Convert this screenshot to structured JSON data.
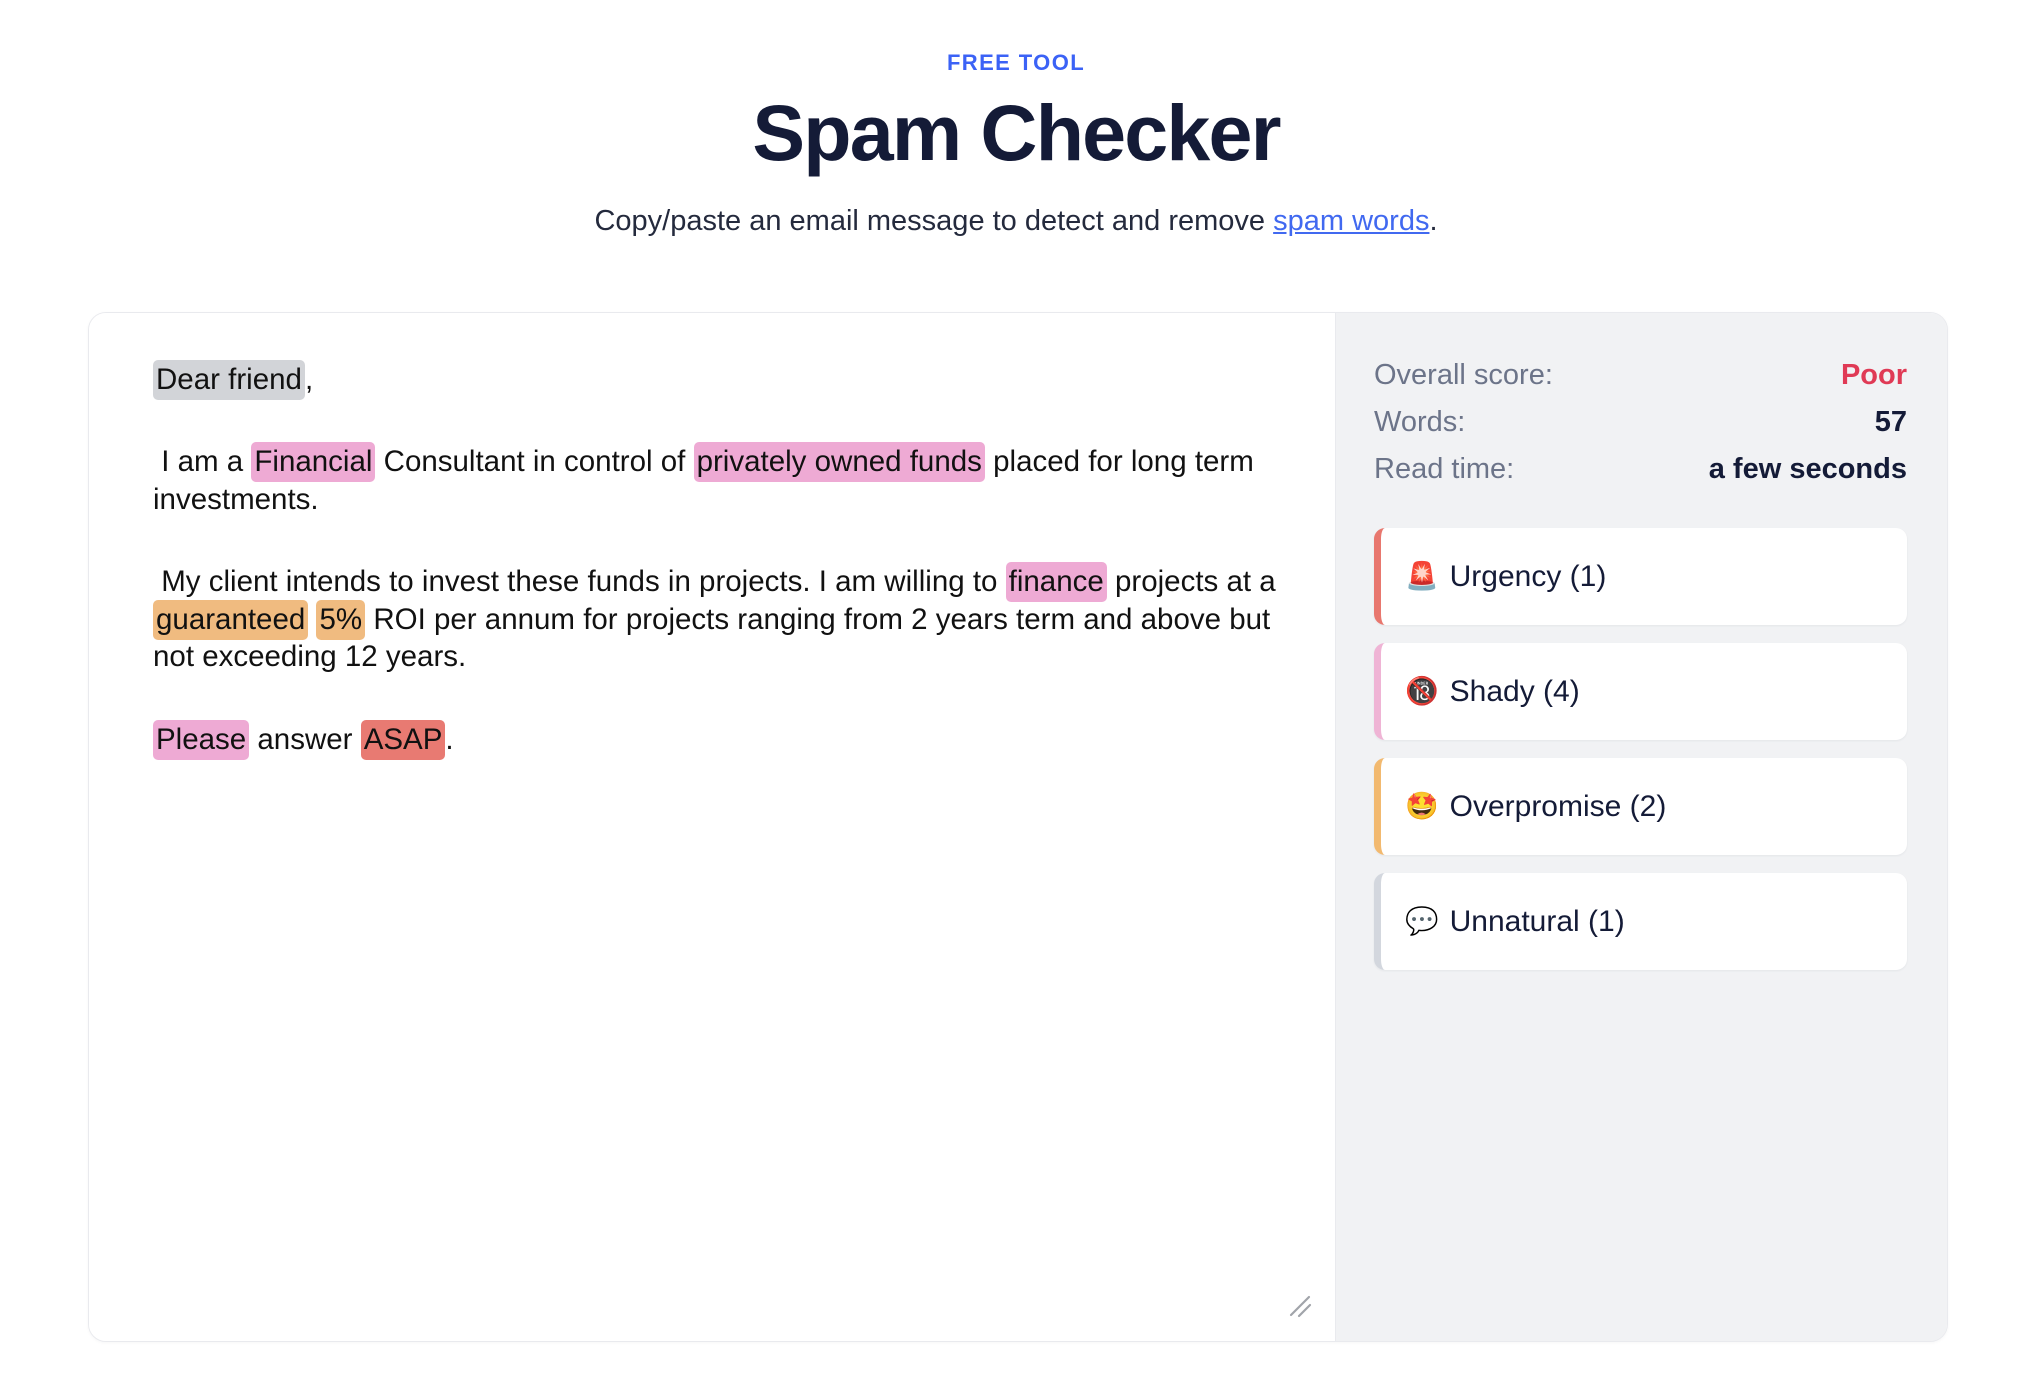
{
  "header": {
    "eyebrow": "FREE TOOL",
    "title": "Spam Checker",
    "subtitle_before": "Copy/paste an email message to detect and remove ",
    "subtitle_link": "spam words",
    "subtitle_after": "."
  },
  "editor": {
    "resize_handle_icon": "resize-grip-icon",
    "paragraphs": [
      [
        {
          "text": "Dear friend",
          "highlight": "neutral"
        },
        {
          "text": ",",
          "highlight": null
        }
      ],
      [
        {
          "text": " I am a ",
          "highlight": null
        },
        {
          "text": "Financial",
          "highlight": "pink"
        },
        {
          "text": " Consultant in control of ",
          "highlight": null
        },
        {
          "text": "privately owned funds",
          "highlight": "pink"
        },
        {
          "text": " placed for long term investments.",
          "highlight": null
        }
      ],
      [
        {
          "text": " My client intends to invest these funds in projects. I am willing to ",
          "highlight": null
        },
        {
          "text": "finance",
          "highlight": "pink"
        },
        {
          "text": " projects at a ",
          "highlight": null
        },
        {
          "text": "guaranteed",
          "highlight": "orange"
        },
        {
          "text": " ",
          "highlight": null
        },
        {
          "text": "5%",
          "highlight": "orange"
        },
        {
          "text": " ROI per annum for projects ranging from 2 years term and above but not exceeding 12 years.",
          "highlight": null
        }
      ],
      [
        {
          "text": "Please",
          "highlight": "pink"
        },
        {
          "text": " answer ",
          "highlight": null
        },
        {
          "text": "ASAP",
          "highlight": "red"
        },
        {
          "text": ".",
          "highlight": null
        }
      ]
    ]
  },
  "results": {
    "stats": [
      {
        "label": "Overall score:",
        "value": "Poor",
        "tone": "bad"
      },
      {
        "label": "Words:",
        "value": "57",
        "tone": "normal"
      },
      {
        "label": "Read time:",
        "value": "a few seconds",
        "tone": "normal"
      }
    ],
    "categories": [
      {
        "emoji": "🚨",
        "icon_name": "siren-emoji-icon",
        "label": "Urgency (1)",
        "accent": "#e8776e"
      },
      {
        "emoji": "🔞",
        "icon_name": "no-one-under-eighteen-emoji-icon",
        "label": "Shady (4)",
        "accent": "#efb4d5"
      },
      {
        "emoji": "🤩",
        "icon_name": "star-struck-emoji-icon",
        "label": "Overpromise (2)",
        "accent": "#f2b96f"
      },
      {
        "emoji": "💬",
        "icon_name": "speech-balloon-emoji-icon",
        "label": "Unnatural (1)",
        "accent": "#d3d7de"
      }
    ]
  },
  "colors": {
    "accent_blue": "#3b62f6",
    "title_navy": "#141b37",
    "bad_red": "#e03a55",
    "highlight_neutral": "#d2d4d8",
    "highlight_pink": "#eeaad4",
    "highlight_orange": "#f0bb80",
    "highlight_red": "#e87a72",
    "panel_bg": "#f1f2f4"
  }
}
